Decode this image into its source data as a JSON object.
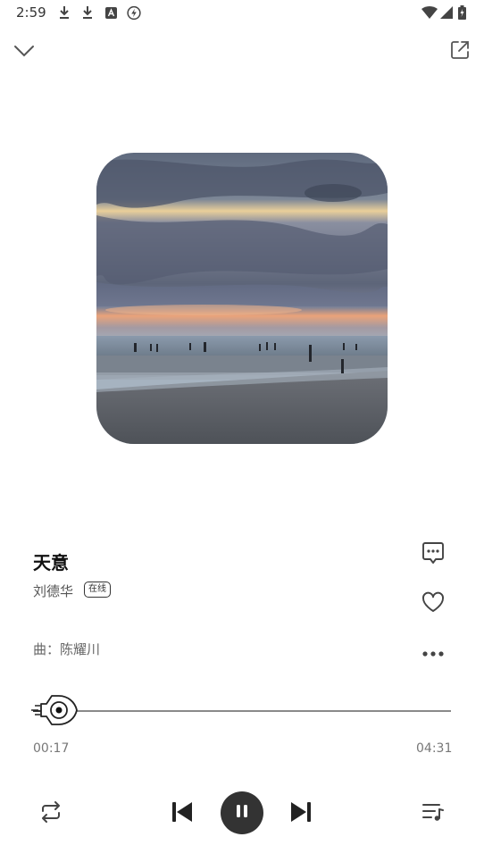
{
  "status_bar": {
    "time": "2:59",
    "left_icons": [
      "download-icon",
      "download-icon",
      "a-badge-icon",
      "bolt-icon"
    ],
    "right_icons": [
      "wifi-icon",
      "signal-icon",
      "battery-icon"
    ]
  },
  "header": {
    "collapse_icon": "chevron-down-icon",
    "share_icon": "external-link-icon"
  },
  "song": {
    "title": "天意",
    "artist": "刘德华",
    "badge": "在线",
    "composer": "曲：陈耀川"
  },
  "actions": {
    "comment_icon": "comment-icon",
    "like_icon": "heart-icon",
    "more_icon": "more-icon"
  },
  "progress": {
    "current": "00:17",
    "total": "04:31",
    "fraction": 0.063
  },
  "controls": {
    "repeat_icon": "repeat-icon",
    "prev_icon": "previous-icon",
    "play_pause_icon": "pause-icon",
    "next_icon": "next-icon",
    "playlist_icon": "playlist-icon"
  },
  "colors": {
    "accent": "#333333",
    "text_primary": "#111111",
    "text_secondary": "#666666"
  }
}
